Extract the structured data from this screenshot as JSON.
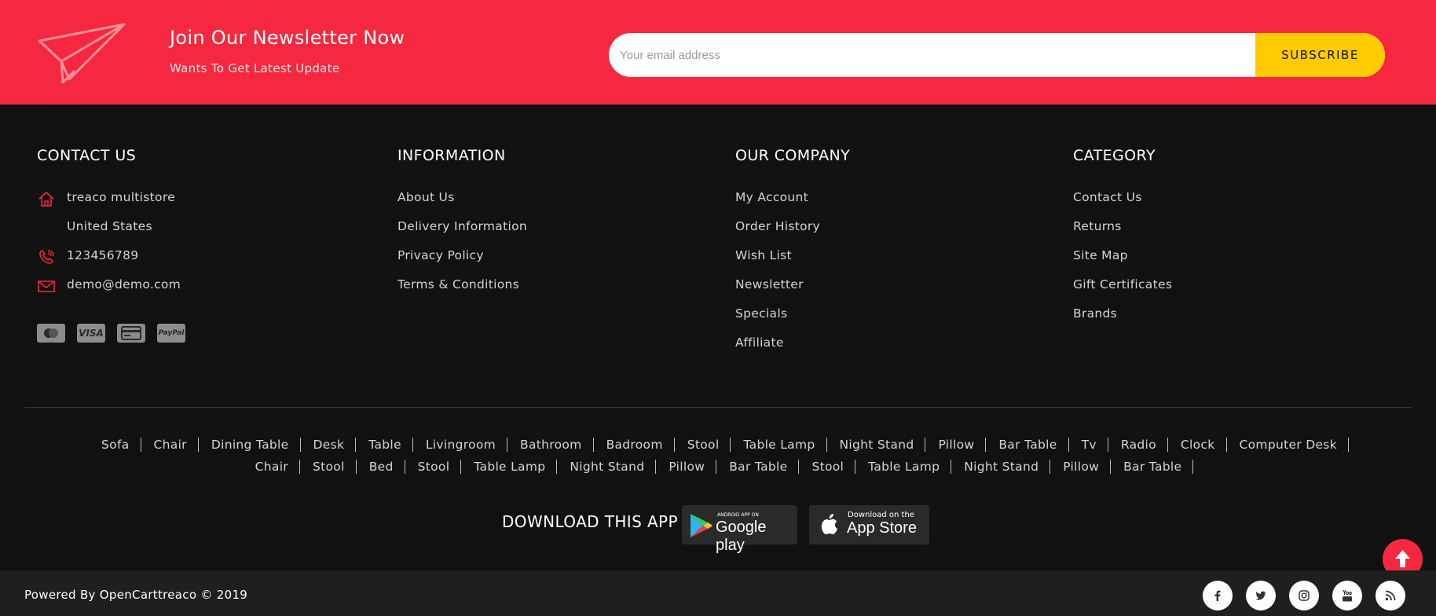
{
  "newsletter": {
    "title": "Join Our Newsletter Now",
    "subtitle": "Wants To Get Latest Update",
    "placeholder": "Your email address",
    "button": "SUBSCRIBE",
    "icon": "paper-plane-icon"
  },
  "contact": {
    "heading": "CONTACT US",
    "name": "treaco multistore",
    "country": "United States",
    "phone": "123456789",
    "email": "demo@demo.com",
    "icons": [
      "home-icon",
      "phone-icon",
      "mail-icon"
    ],
    "payments": [
      "mastercard-icon",
      "visa-icon",
      "credit-card-icon",
      "paypal-icon"
    ],
    "payment_labels": {
      "visa": "VISA",
      "paypal": "PayPal"
    }
  },
  "information": {
    "heading": "INFORMATION",
    "links": [
      "About Us",
      "Delivery Information",
      "Privacy Policy",
      "Terms & Conditions"
    ]
  },
  "company": {
    "heading": "OUR COMPANY",
    "links": [
      "My Account",
      "Order History",
      "Wish List",
      "Newsletter",
      "Specials",
      "Affiliate"
    ]
  },
  "category": {
    "heading": "CATEGORY",
    "links": [
      "Contact Us",
      "Returns",
      "Site Map",
      "Gift Certificates",
      "Brands"
    ]
  },
  "tags": {
    "row1": [
      "Sofa",
      "Chair",
      "Dining Table",
      "Desk",
      "Table",
      "Livingroom",
      "Bathroom",
      "Badroom",
      "Stool",
      "Table Lamp",
      "Night Stand",
      "Pillow",
      "Bar Table",
      "Tv",
      "Radio",
      "Clock",
      "Computer Desk"
    ],
    "row2": [
      "Chair",
      "Stool",
      "Bed",
      "Stool",
      "Table Lamp",
      "Night Stand",
      "Pillow",
      "Bar Table",
      "Stool",
      "Table Lamp",
      "Night Stand",
      "Pillow",
      "Bar Table"
    ]
  },
  "app": {
    "label": "DOWNLOAD THIS APP",
    "google_small": "ANDROID APP ON",
    "google_big": "Google play",
    "apple_small": "Download on the",
    "apple_big": "App Store"
  },
  "footer": {
    "powered": "Powered By OpenCarttreaco © 2019",
    "social": [
      "facebook-icon",
      "twitter-icon",
      "instagram-icon",
      "youtube-icon",
      "rss-icon"
    ]
  },
  "colors": {
    "accent": "#f5283f",
    "button": "#fecb00",
    "background": "#111111",
    "bottom_bar": "#1f1f1f"
  }
}
